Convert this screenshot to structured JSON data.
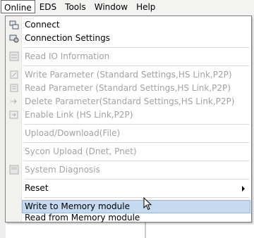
{
  "menubar": {
    "items": [
      {
        "label": "Online"
      },
      {
        "label": "EDS"
      },
      {
        "label": "Tools"
      },
      {
        "label": "Window"
      },
      {
        "label": "Help"
      }
    ]
  },
  "menu": {
    "connect": "Connect",
    "connection_settings": "Connection Settings",
    "read_io": "Read IO Information",
    "write_param": "Write Parameter (Standard Settings,HS Link,P2P)",
    "read_param": "Read Parameter (Standard Settings,HS Link,P2P)",
    "delete_param": "Delete Parameter(Standard Settings,HS Link,P2P)",
    "enable_link": "Enable Link (HS Link,P2P)",
    "upload_download": "Upload/Download(File)",
    "sycon_upload": "Sycon Upload (Dnet, Pnet)",
    "system_diagnosis": "System Diagnosis",
    "reset": "Reset",
    "write_memory": "Write to Memory module",
    "read_memory": "Read from Memory module"
  },
  "colors": {
    "highlight": "#c5d9f1",
    "disabled_text": "#a2a2a2"
  }
}
